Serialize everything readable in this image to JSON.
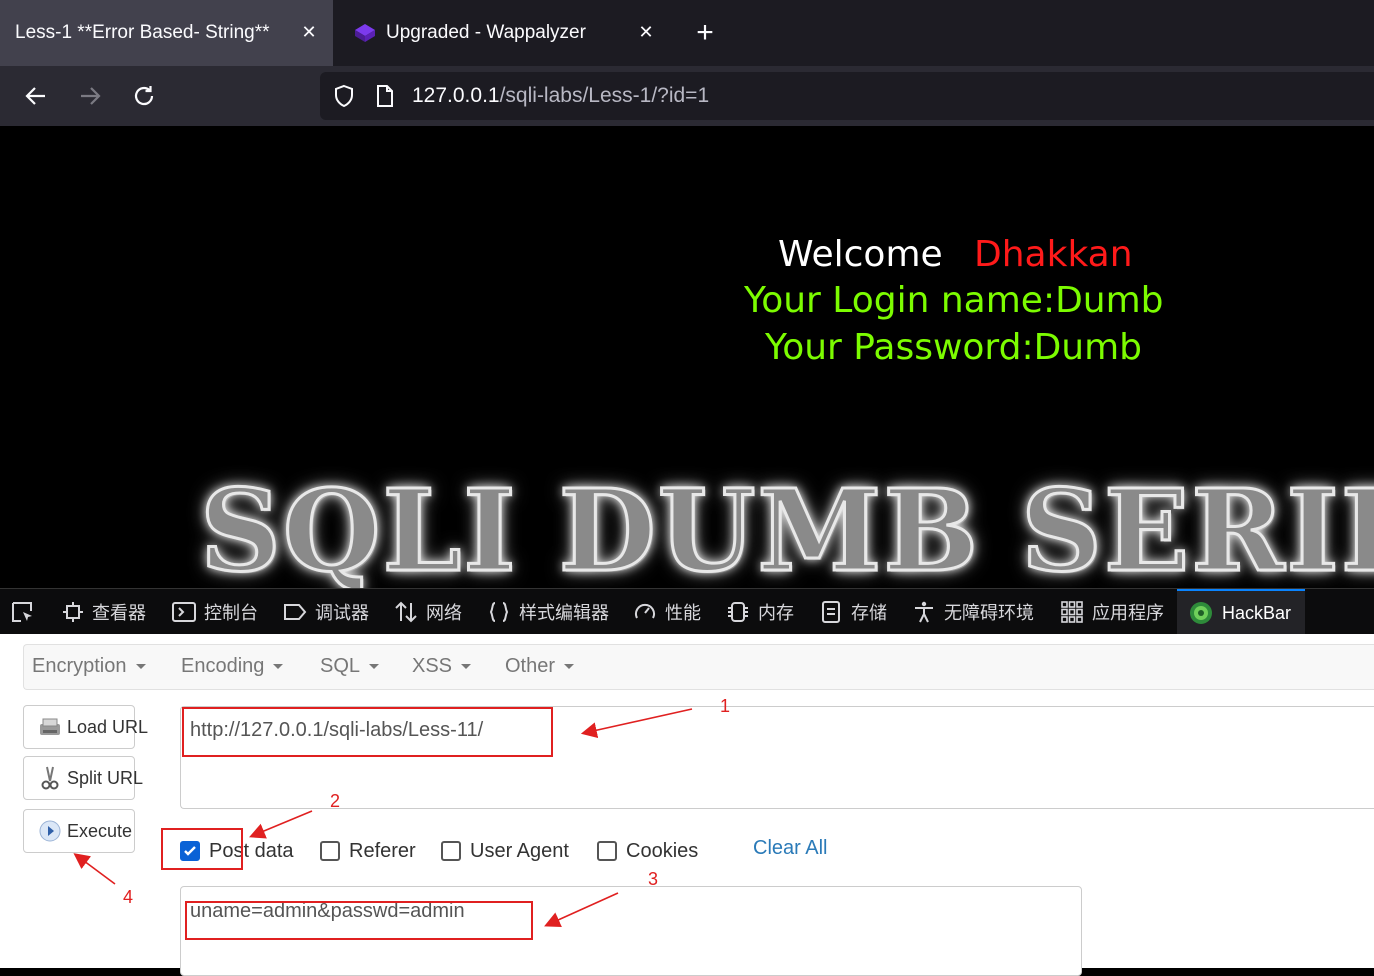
{
  "browser": {
    "tabs": [
      {
        "title": "Less-1 **Error Based- String**",
        "active": true
      },
      {
        "title": "Upgraded - Wappalyzer",
        "active": false
      }
    ],
    "close_glyph": "✕",
    "new_tab_glyph": "+",
    "address": {
      "host": "127.0.0.1",
      "path": "/sqli-labs/Less-1/?id=1"
    }
  },
  "page": {
    "welcome_label": "Welcome",
    "welcome_name": "Dhakkan",
    "login_line": "Your Login name:Dumb",
    "password_line": "Your Password:Dumb",
    "banner": "SQLI DUMB SERIES",
    "colors": {
      "welcome": "#ffffff",
      "name": "#ff1a1a",
      "info": "#7cfc00"
    }
  },
  "devtools": {
    "tabs": [
      {
        "label": "查看器",
        "icon": "inspector-icon"
      },
      {
        "label": "控制台",
        "icon": "console-icon"
      },
      {
        "label": "调试器",
        "icon": "debugger-icon"
      },
      {
        "label": "网络",
        "icon": "network-icon"
      },
      {
        "label": "样式编辑器",
        "icon": "style-editor-icon"
      },
      {
        "label": "性能",
        "icon": "performance-icon"
      },
      {
        "label": "内存",
        "icon": "memory-icon"
      },
      {
        "label": "存储",
        "icon": "storage-icon"
      },
      {
        "label": "无障碍环境",
        "icon": "accessibility-icon"
      },
      {
        "label": "应用程序",
        "icon": "application-icon"
      },
      {
        "label": "HackBar",
        "icon": "hackbar-icon",
        "selected": true
      }
    ]
  },
  "hackbar": {
    "menus": [
      "Encryption",
      "Encoding",
      "SQL",
      "XSS",
      "Other"
    ],
    "buttons": {
      "load_url": "Load URL",
      "split_url": "Split URL",
      "execute": "Execute"
    },
    "url_value": "http://127.0.0.1/sqli-labs/Less-11/",
    "options": {
      "post_data": {
        "label": "Post data",
        "checked": true
      },
      "referer": {
        "label": "Referer",
        "checked": false
      },
      "user_agent": {
        "label": "User Agent",
        "checked": false
      },
      "cookies": {
        "label": "Cookies",
        "checked": false
      }
    },
    "clear_all": "Clear All",
    "post_value": "uname=admin&passwd=admin"
  },
  "annotations": {
    "labels": [
      "1",
      "2",
      "3",
      "4"
    ],
    "color": "#e02020"
  }
}
